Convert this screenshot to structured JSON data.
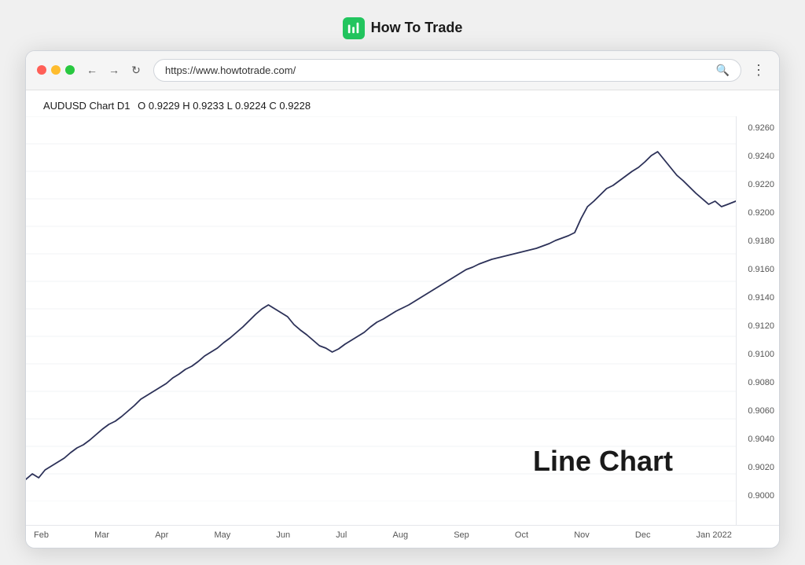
{
  "topBar": {
    "title": "How To Trade",
    "logoColor": "#22c55e"
  },
  "browser": {
    "url": "https://www.howtotrade.com/",
    "trafficLights": [
      "red",
      "yellow",
      "green"
    ]
  },
  "chart": {
    "title": "AUDUSD Chart D1",
    "ohlc": "O 0.9229  H 0.9233  L 0.9224  C 0.9228",
    "yLabels": [
      "0.9260",
      "0.9240",
      "0.9220",
      "0.9200",
      "0.9180",
      "0.9160",
      "0.9140",
      "0.9120",
      "0.9100",
      "0.9080",
      "0.9060",
      "0.9040",
      "0.9020",
      "0.9000"
    ],
    "xLabels": [
      "Feb",
      "Mar",
      "Apr",
      "May",
      "Jun",
      "Jul",
      "Aug",
      "Sep",
      "Oct",
      "Nov",
      "Dec",
      "Jan 2022"
    ],
    "watermark": "Line Chart"
  }
}
